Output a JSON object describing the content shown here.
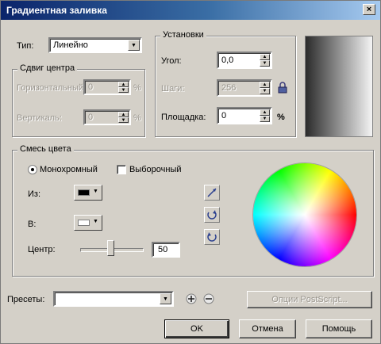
{
  "window": {
    "title": "Градиентная заливка",
    "close_glyph": "×"
  },
  "type": {
    "label": "Тип:",
    "value": "Линейно",
    "arrow": "▼"
  },
  "center_offset": {
    "title": "Сдвиг центра",
    "horizontal": {
      "label": "Горизонтальный:",
      "value": "0",
      "unit": "%"
    },
    "vertical": {
      "label": "Вертикаль:",
      "value": "0",
      "unit": "%"
    }
  },
  "settings": {
    "title": "Установки",
    "angle": {
      "label": "Угол:",
      "value": "0,0"
    },
    "steps": {
      "label": "Шаги:",
      "value": "256"
    },
    "edge_pad": {
      "label": "Площадка:",
      "value": "0",
      "unit": "%"
    },
    "lock_icon": "lock-icon"
  },
  "preview": {
    "from": "#2b2b2b",
    "to": "#f4f4f4"
  },
  "color_blend": {
    "title": "Смесь цвета",
    "two_color_label": "Монохромный",
    "custom_label": "Выборочный",
    "from": {
      "label": "Из:",
      "color": "#000000"
    },
    "to": {
      "label": "В:",
      "color": "#ffffff"
    },
    "midpoint": {
      "label": "Центр:",
      "value": "50",
      "slider_value": 50
    },
    "direction_icons": [
      "direct-path-icon",
      "counterclockwise-path-icon",
      "clockwise-path-icon"
    ]
  },
  "presets": {
    "label": "Пресеты:",
    "value": "",
    "add_icon": "plus-icon",
    "remove_icon": "minus-icon",
    "postscript_label": "Опции PostScript..."
  },
  "buttons": {
    "ok": "OK",
    "cancel": "Отмена",
    "help": "Помощь"
  }
}
